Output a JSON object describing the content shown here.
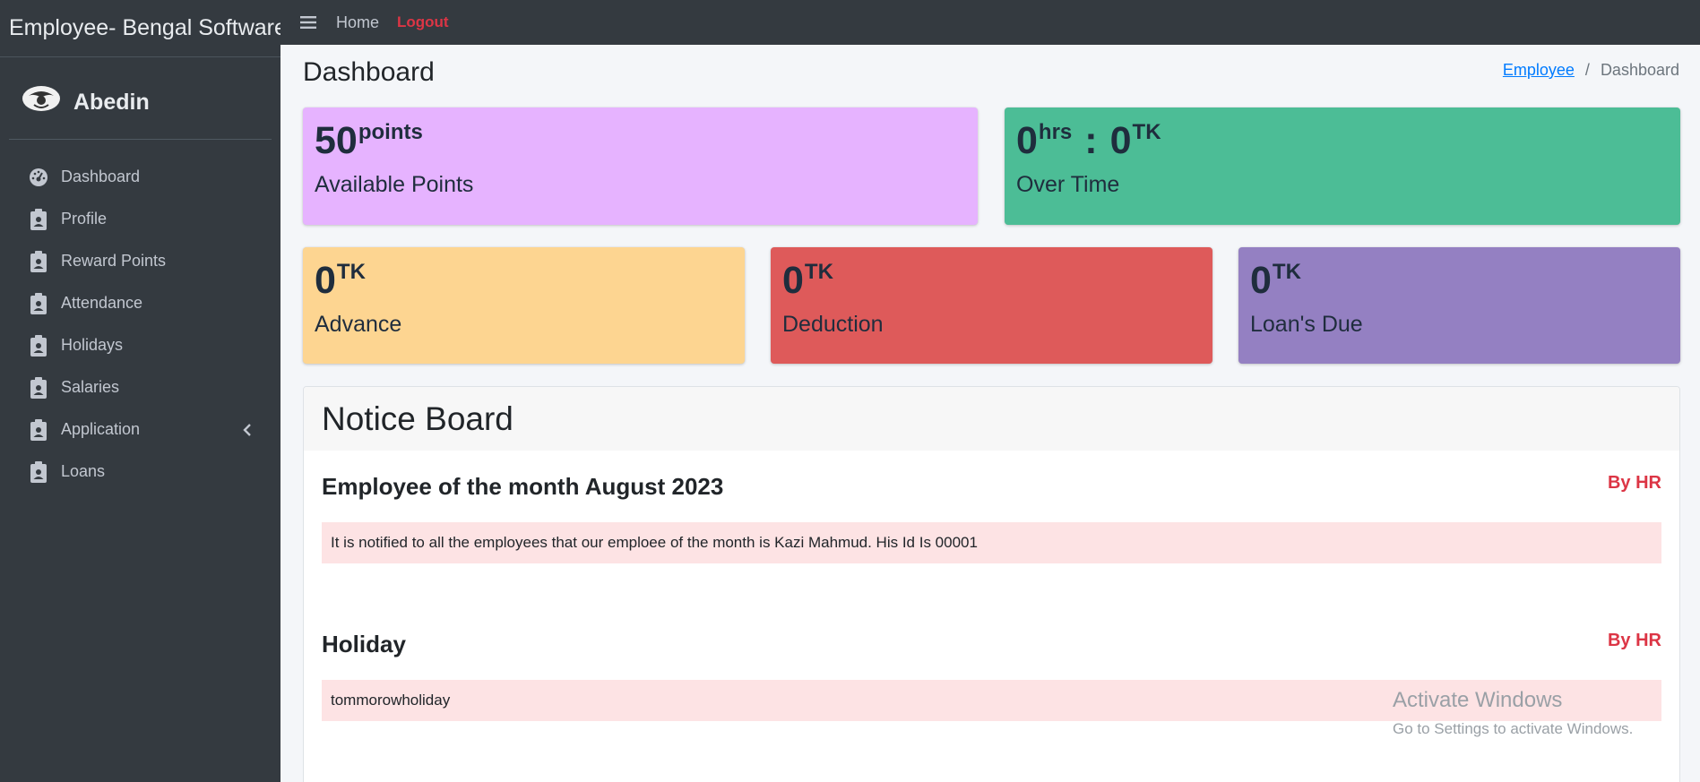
{
  "sidebar": {
    "brand": "Employee- Bengal Software",
    "user": "Abedin",
    "items": [
      {
        "label": "Dashboard",
        "icon": "gauge-icon"
      },
      {
        "label": "Profile",
        "icon": "id-badge-icon"
      },
      {
        "label": "Reward Points",
        "icon": "id-badge-icon"
      },
      {
        "label": "Attendance",
        "icon": "id-badge-icon"
      },
      {
        "label": "Holidays",
        "icon": "id-badge-icon"
      },
      {
        "label": "Salaries",
        "icon": "id-badge-icon"
      },
      {
        "label": "Application",
        "icon": "id-badge-icon"
      },
      {
        "label": "Loans",
        "icon": "id-badge-icon"
      }
    ]
  },
  "topbar": {
    "home": "Home",
    "logout": "Logout"
  },
  "page": {
    "title": "Dashboard",
    "breadcrumb": {
      "link": "Employee",
      "separator": "/",
      "current": "Dashboard"
    }
  },
  "stats": {
    "points": {
      "value": "50",
      "unit": "points",
      "label": "Available Points",
      "color": "#e6b3ff"
    },
    "overtime": {
      "hours": "0",
      "hours_unit": "hrs",
      "separator": ":",
      "amount": "0",
      "amount_unit": "TK",
      "label": "Over Time",
      "color": "#4cbd96"
    },
    "advance": {
      "value": "0",
      "unit": "TK",
      "label": "Advance",
      "color": "#fdd591"
    },
    "deduction": {
      "value": "0",
      "unit": "TK",
      "label": "Deduction",
      "color": "#de5a5a"
    },
    "loans_due": {
      "value": "0",
      "unit": "TK",
      "label": "Loan's Due",
      "color": "#9480c2"
    }
  },
  "notice_board": {
    "title": "Notice Board",
    "notices": [
      {
        "title": "Employee of the month August 2023",
        "author": "By HR",
        "message": "It is notified to all the employees that our emploee of the month is Kazi Mahmud. His Id Is 00001"
      },
      {
        "title": "Holiday",
        "author": "By HR",
        "message": "tommorowholiday"
      }
    ]
  },
  "watermark": {
    "line1": "Activate Windows",
    "line2": "Go to Settings to activate Windows."
  }
}
